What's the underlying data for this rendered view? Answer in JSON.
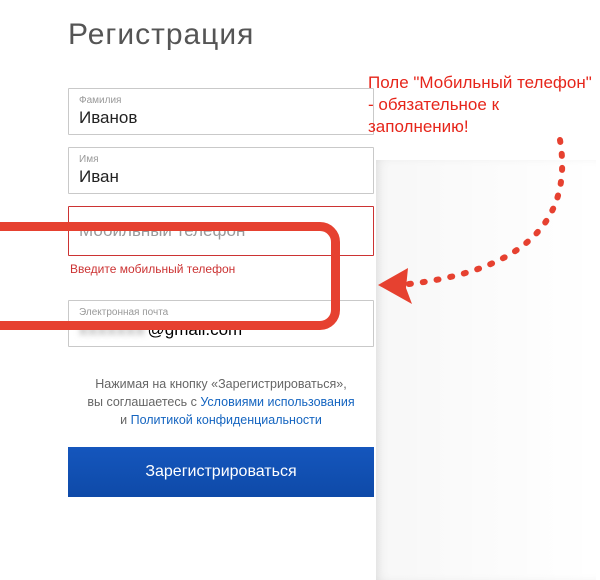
{
  "title": "Регистрация",
  "annotation": "Поле \"Мобильный телефон\" - обязательное к заполнению!",
  "fields": {
    "surname": {
      "label": "Фамилия",
      "value": "Иванов"
    },
    "name": {
      "label": "Имя",
      "value": "Иван"
    },
    "phone": {
      "placeholder": "Мобильный телефон",
      "error": "Введите мобильный телефон"
    },
    "email": {
      "label": "Электронная почта",
      "visible_suffix": "@gmail.com"
    }
  },
  "terms": {
    "line1_a": "Нажимая на кнопку «Зарегистрироваться»,",
    "line2_a": "вы соглашаетесь с ",
    "tos": "Условиями использования",
    "and": " и ",
    "privacy": "Политикой конфиденциальности"
  },
  "submit": "Зарегистрироваться",
  "colors": {
    "accent": "#e64130",
    "button": "#0e4aa8"
  }
}
